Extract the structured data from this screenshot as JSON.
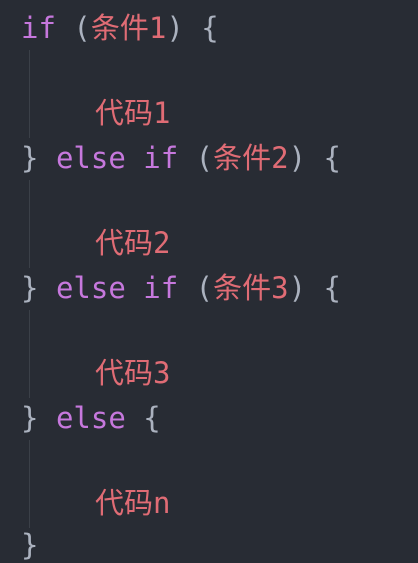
{
  "code": {
    "kw_if": "if",
    "kw_else": "else",
    "open_paren": "(",
    "close_paren_brace": ") {",
    "close_brace": "}",
    "open_brace": "{",
    "cond1": "条件1",
    "cond2": "条件2",
    "cond3": "条件3",
    "body1": "代码1",
    "body2": "代码2",
    "body3": "代码3",
    "bodyn": "代码n"
  },
  "colors": {
    "background": "#282c34",
    "keyword": "#c678dd",
    "string": "#e06c75",
    "punctuation": "#abb2bf"
  }
}
